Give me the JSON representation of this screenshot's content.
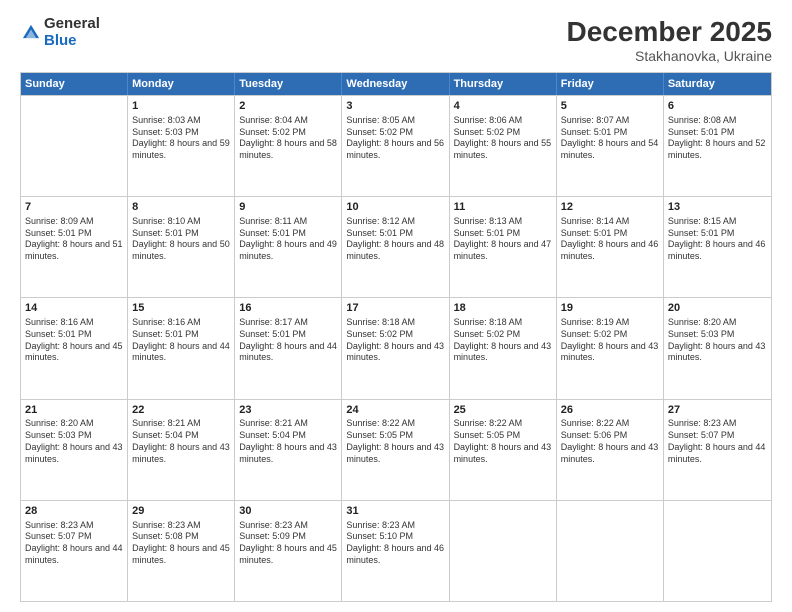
{
  "logo": {
    "general": "General",
    "blue": "Blue"
  },
  "title": "December 2025",
  "location": "Stakhanovka, Ukraine",
  "days": [
    "Sunday",
    "Monday",
    "Tuesday",
    "Wednesday",
    "Thursday",
    "Friday",
    "Saturday"
  ],
  "weeks": [
    [
      {
        "day": "",
        "sunrise": "",
        "sunset": "",
        "daylight": ""
      },
      {
        "day": "1",
        "sunrise": "Sunrise: 8:03 AM",
        "sunset": "Sunset: 5:03 PM",
        "daylight": "Daylight: 8 hours and 59 minutes."
      },
      {
        "day": "2",
        "sunrise": "Sunrise: 8:04 AM",
        "sunset": "Sunset: 5:02 PM",
        "daylight": "Daylight: 8 hours and 58 minutes."
      },
      {
        "day": "3",
        "sunrise": "Sunrise: 8:05 AM",
        "sunset": "Sunset: 5:02 PM",
        "daylight": "Daylight: 8 hours and 56 minutes."
      },
      {
        "day": "4",
        "sunrise": "Sunrise: 8:06 AM",
        "sunset": "Sunset: 5:02 PM",
        "daylight": "Daylight: 8 hours and 55 minutes."
      },
      {
        "day": "5",
        "sunrise": "Sunrise: 8:07 AM",
        "sunset": "Sunset: 5:01 PM",
        "daylight": "Daylight: 8 hours and 54 minutes."
      },
      {
        "day": "6",
        "sunrise": "Sunrise: 8:08 AM",
        "sunset": "Sunset: 5:01 PM",
        "daylight": "Daylight: 8 hours and 52 minutes."
      }
    ],
    [
      {
        "day": "7",
        "sunrise": "Sunrise: 8:09 AM",
        "sunset": "Sunset: 5:01 PM",
        "daylight": "Daylight: 8 hours and 51 minutes."
      },
      {
        "day": "8",
        "sunrise": "Sunrise: 8:10 AM",
        "sunset": "Sunset: 5:01 PM",
        "daylight": "Daylight: 8 hours and 50 minutes."
      },
      {
        "day": "9",
        "sunrise": "Sunrise: 8:11 AM",
        "sunset": "Sunset: 5:01 PM",
        "daylight": "Daylight: 8 hours and 49 minutes."
      },
      {
        "day": "10",
        "sunrise": "Sunrise: 8:12 AM",
        "sunset": "Sunset: 5:01 PM",
        "daylight": "Daylight: 8 hours and 48 minutes."
      },
      {
        "day": "11",
        "sunrise": "Sunrise: 8:13 AM",
        "sunset": "Sunset: 5:01 PM",
        "daylight": "Daylight: 8 hours and 47 minutes."
      },
      {
        "day": "12",
        "sunrise": "Sunrise: 8:14 AM",
        "sunset": "Sunset: 5:01 PM",
        "daylight": "Daylight: 8 hours and 46 minutes."
      },
      {
        "day": "13",
        "sunrise": "Sunrise: 8:15 AM",
        "sunset": "Sunset: 5:01 PM",
        "daylight": "Daylight: 8 hours and 46 minutes."
      }
    ],
    [
      {
        "day": "14",
        "sunrise": "Sunrise: 8:16 AM",
        "sunset": "Sunset: 5:01 PM",
        "daylight": "Daylight: 8 hours and 45 minutes."
      },
      {
        "day": "15",
        "sunrise": "Sunrise: 8:16 AM",
        "sunset": "Sunset: 5:01 PM",
        "daylight": "Daylight: 8 hours and 44 minutes."
      },
      {
        "day": "16",
        "sunrise": "Sunrise: 8:17 AM",
        "sunset": "Sunset: 5:01 PM",
        "daylight": "Daylight: 8 hours and 44 minutes."
      },
      {
        "day": "17",
        "sunrise": "Sunrise: 8:18 AM",
        "sunset": "Sunset: 5:02 PM",
        "daylight": "Daylight: 8 hours and 43 minutes."
      },
      {
        "day": "18",
        "sunrise": "Sunrise: 8:18 AM",
        "sunset": "Sunset: 5:02 PM",
        "daylight": "Daylight: 8 hours and 43 minutes."
      },
      {
        "day": "19",
        "sunrise": "Sunrise: 8:19 AM",
        "sunset": "Sunset: 5:02 PM",
        "daylight": "Daylight: 8 hours and 43 minutes."
      },
      {
        "day": "20",
        "sunrise": "Sunrise: 8:20 AM",
        "sunset": "Sunset: 5:03 PM",
        "daylight": "Daylight: 8 hours and 43 minutes."
      }
    ],
    [
      {
        "day": "21",
        "sunrise": "Sunrise: 8:20 AM",
        "sunset": "Sunset: 5:03 PM",
        "daylight": "Daylight: 8 hours and 43 minutes."
      },
      {
        "day": "22",
        "sunrise": "Sunrise: 8:21 AM",
        "sunset": "Sunset: 5:04 PM",
        "daylight": "Daylight: 8 hours and 43 minutes."
      },
      {
        "day": "23",
        "sunrise": "Sunrise: 8:21 AM",
        "sunset": "Sunset: 5:04 PM",
        "daylight": "Daylight: 8 hours and 43 minutes."
      },
      {
        "day": "24",
        "sunrise": "Sunrise: 8:22 AM",
        "sunset": "Sunset: 5:05 PM",
        "daylight": "Daylight: 8 hours and 43 minutes."
      },
      {
        "day": "25",
        "sunrise": "Sunrise: 8:22 AM",
        "sunset": "Sunset: 5:05 PM",
        "daylight": "Daylight: 8 hours and 43 minutes."
      },
      {
        "day": "26",
        "sunrise": "Sunrise: 8:22 AM",
        "sunset": "Sunset: 5:06 PM",
        "daylight": "Daylight: 8 hours and 43 minutes."
      },
      {
        "day": "27",
        "sunrise": "Sunrise: 8:23 AM",
        "sunset": "Sunset: 5:07 PM",
        "daylight": "Daylight: 8 hours and 44 minutes."
      }
    ],
    [
      {
        "day": "28",
        "sunrise": "Sunrise: 8:23 AM",
        "sunset": "Sunset: 5:07 PM",
        "daylight": "Daylight: 8 hours and 44 minutes."
      },
      {
        "day": "29",
        "sunrise": "Sunrise: 8:23 AM",
        "sunset": "Sunset: 5:08 PM",
        "daylight": "Daylight: 8 hours and 45 minutes."
      },
      {
        "day": "30",
        "sunrise": "Sunrise: 8:23 AM",
        "sunset": "Sunset: 5:09 PM",
        "daylight": "Daylight: 8 hours and 45 minutes."
      },
      {
        "day": "31",
        "sunrise": "Sunrise: 8:23 AM",
        "sunset": "Sunset: 5:10 PM",
        "daylight": "Daylight: 8 hours and 46 minutes."
      },
      {
        "day": "",
        "sunrise": "",
        "sunset": "",
        "daylight": ""
      },
      {
        "day": "",
        "sunrise": "",
        "sunset": "",
        "daylight": ""
      },
      {
        "day": "",
        "sunrise": "",
        "sunset": "",
        "daylight": ""
      }
    ]
  ]
}
